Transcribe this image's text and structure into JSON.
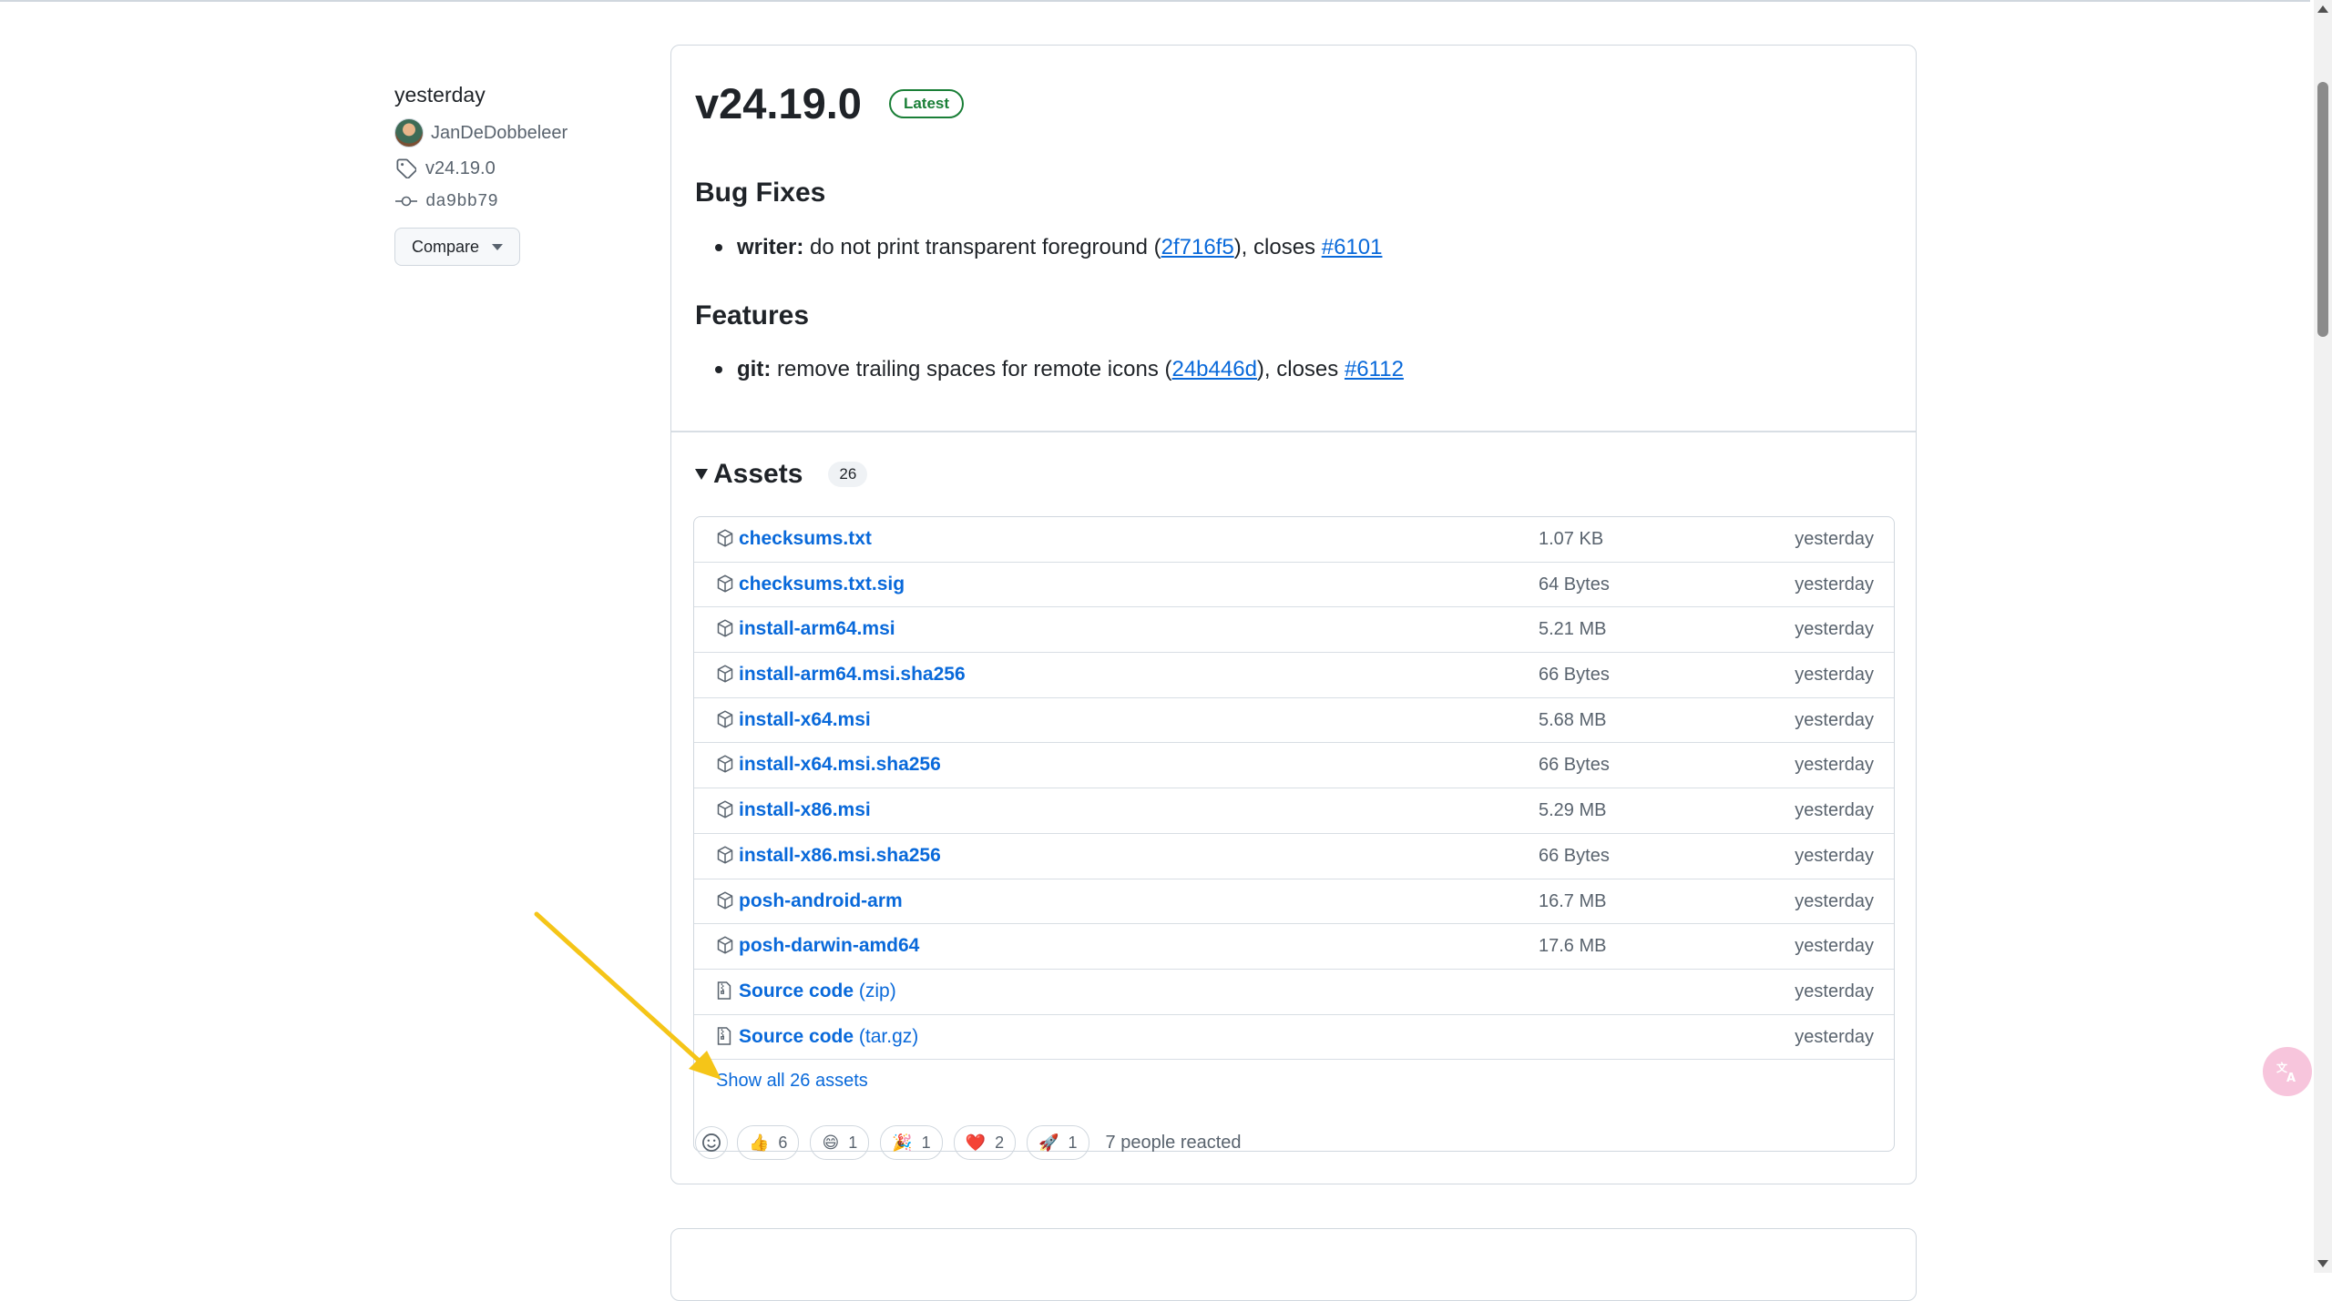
{
  "meta": {
    "date": "yesterday",
    "author": "JanDeDobbeleer",
    "tag": "v24.19.0",
    "commit": "da9bb79",
    "compare_label": "Compare"
  },
  "release": {
    "title": "v24.19.0",
    "latest_label": "Latest",
    "bug_fixes_heading": "Bug Fixes",
    "bug_fix": {
      "scope": "writer:",
      "text": "do not print transparent foreground (",
      "commit": "2f716f5",
      "closes_text": "), closes",
      "issue": "#6101"
    },
    "features_heading": "Features",
    "feature": {
      "scope": "git:",
      "text": "remove trailing spaces for remote icons (",
      "commit": "24b446d",
      "closes_text": "), closes",
      "issue": "#6112"
    }
  },
  "assets": {
    "heading": "Assets",
    "count": "26",
    "rows": [
      {
        "name": "checksums.txt",
        "size": "1.07 KB",
        "date": "yesterday",
        "icon": "package-icon"
      },
      {
        "name": "checksums.txt.sig",
        "size": "64 Bytes",
        "date": "yesterday",
        "icon": "package-icon"
      },
      {
        "name": "install-arm64.msi",
        "size": "5.21 MB",
        "date": "yesterday",
        "icon": "package-icon"
      },
      {
        "name": "install-arm64.msi.sha256",
        "size": "66 Bytes",
        "date": "yesterday",
        "icon": "package-icon"
      },
      {
        "name": "install-x64.msi",
        "size": "5.68 MB",
        "date": "yesterday",
        "icon": "package-icon"
      },
      {
        "name": "install-x64.msi.sha256",
        "size": "66 Bytes",
        "date": "yesterday",
        "icon": "package-icon"
      },
      {
        "name": "install-x86.msi",
        "size": "5.29 MB",
        "date": "yesterday",
        "icon": "package-icon"
      },
      {
        "name": "install-x86.msi.sha256",
        "size": "66 Bytes",
        "date": "yesterday",
        "icon": "package-icon"
      },
      {
        "name": "posh-android-arm",
        "size": "16.7 MB",
        "date": "yesterday",
        "icon": "package-icon"
      },
      {
        "name": "posh-darwin-amd64",
        "size": "17.6 MB",
        "date": "yesterday",
        "icon": "package-icon"
      }
    ],
    "source_rows": [
      {
        "name": "Source code",
        "format": "(zip)",
        "date": "yesterday",
        "icon": "file-zip-icon"
      },
      {
        "name": "Source code",
        "format": "(tar.gz)",
        "date": "yesterday",
        "icon": "file-zip-icon"
      }
    ],
    "show_all_label": "Show all 26 assets"
  },
  "reactions": {
    "items": [
      {
        "emoji": "👍",
        "count": "6"
      },
      {
        "emoji": "😄",
        "count": "1"
      },
      {
        "emoji": "🎉",
        "count": "1"
      },
      {
        "emoji": "❤️",
        "count": "2"
      },
      {
        "emoji": "🚀",
        "count": "1"
      }
    ],
    "summary": "7 people reacted"
  },
  "colors": {
    "link": "#0969da",
    "latest": "#1a7f37",
    "annotation_arrow": "#f5c518"
  }
}
